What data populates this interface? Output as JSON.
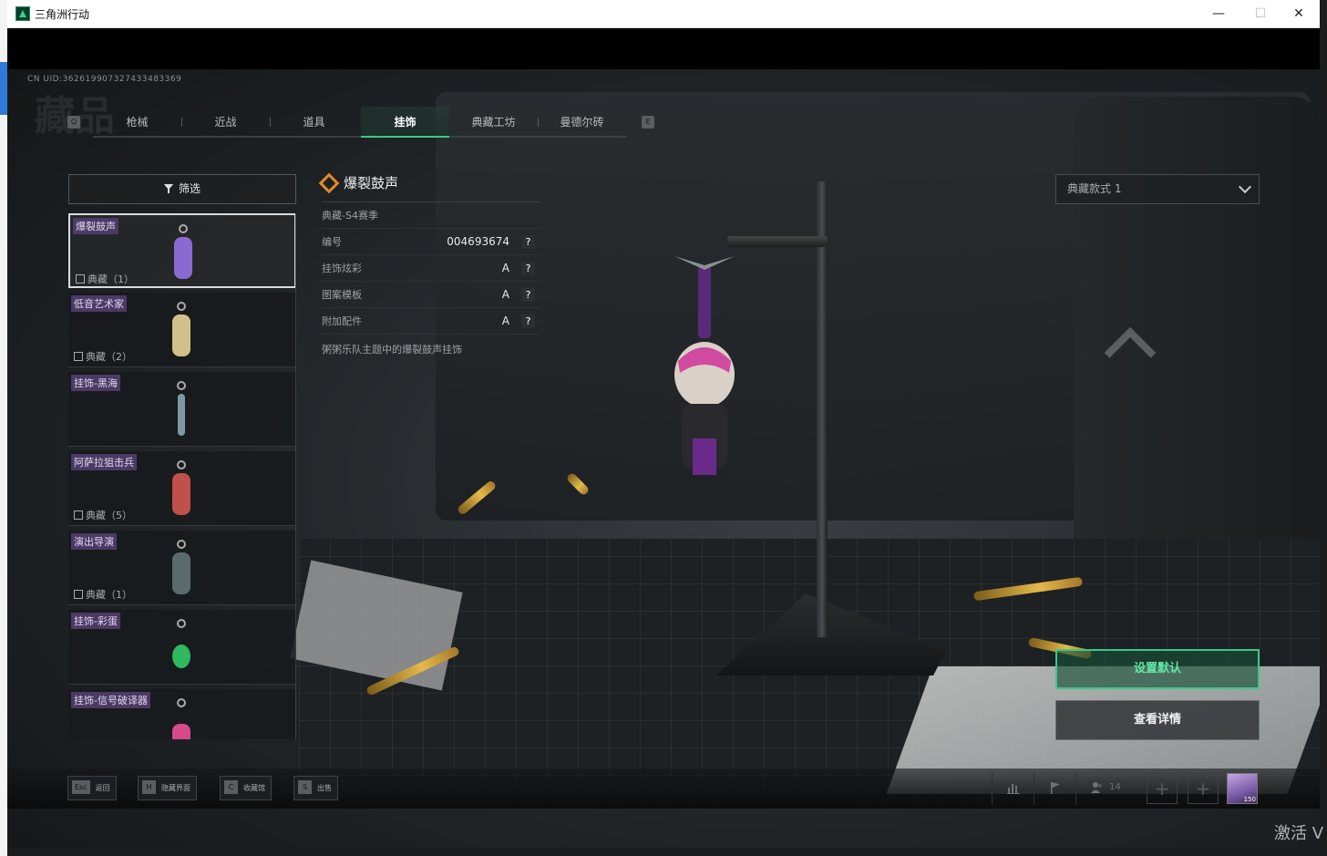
{
  "window": {
    "title": "三角洲行动",
    "minimize": "—",
    "maximize": "☐",
    "close": "✕"
  },
  "uid": "CN UID:362619907327433483369",
  "watermark_title": "藏品",
  "tabs": {
    "left_key": "Q",
    "right_key": "E",
    "items": [
      {
        "label": "枪械"
      },
      {
        "label": "近战"
      },
      {
        "label": "道具"
      },
      {
        "label": "挂饰"
      },
      {
        "label": "典藏工坊"
      },
      {
        "label": "曼德尔砖"
      }
    ],
    "active_index": 3
  },
  "filter": {
    "label": "筛选"
  },
  "list": {
    "items": [
      {
        "name": "爆裂鼓声",
        "count": "典藏（1）",
        "color": "#8a6ad0"
      },
      {
        "name": "低音艺术家",
        "count": "典藏（2）",
        "color": "#d2c08a"
      },
      {
        "name": "挂饰-黑海",
        "count": "",
        "color": "#7f97a8"
      },
      {
        "name": "阿萨拉狙击兵",
        "count": "典藏（5）",
        "color": "#c0504a"
      },
      {
        "name": "演出导演",
        "count": "典藏（1）",
        "color": "#5a6a6f"
      },
      {
        "name": "挂饰-彩蛋",
        "count": "",
        "color": "#2fb85e"
      },
      {
        "name": "挂饰-信号破译器",
        "count": "",
        "color": "#d64a8a"
      }
    ],
    "selected_index": 0
  },
  "detail": {
    "title": "爆裂鼓声",
    "season": "典藏-S4赛季",
    "rows": [
      {
        "label": "编号",
        "value": "004693674"
      },
      {
        "label": "挂饰炫彩",
        "value": "A"
      },
      {
        "label": "图案模板",
        "value": "A"
      },
      {
        "label": "附加配件",
        "value": "A"
      }
    ],
    "help": "?",
    "description": "粥粥乐队主题中的爆裂鼓声挂饰"
  },
  "style_select": {
    "value": "典藏款式 1"
  },
  "actions": {
    "set_default": "设置默认",
    "view_details": "查看详情"
  },
  "bottom_hints": [
    {
      "key": "Esc",
      "label": "返回"
    },
    {
      "key": "H",
      "label": "隐藏界面"
    },
    {
      "key": "C",
      "label": "收藏馆"
    },
    {
      "key": "S",
      "label": "出售"
    }
  ],
  "bottom_right": {
    "friends_count": "14",
    "plus": "+",
    "avatar_label": "150"
  },
  "activate_text": "激活 V",
  "accent_color": "#39c98a"
}
